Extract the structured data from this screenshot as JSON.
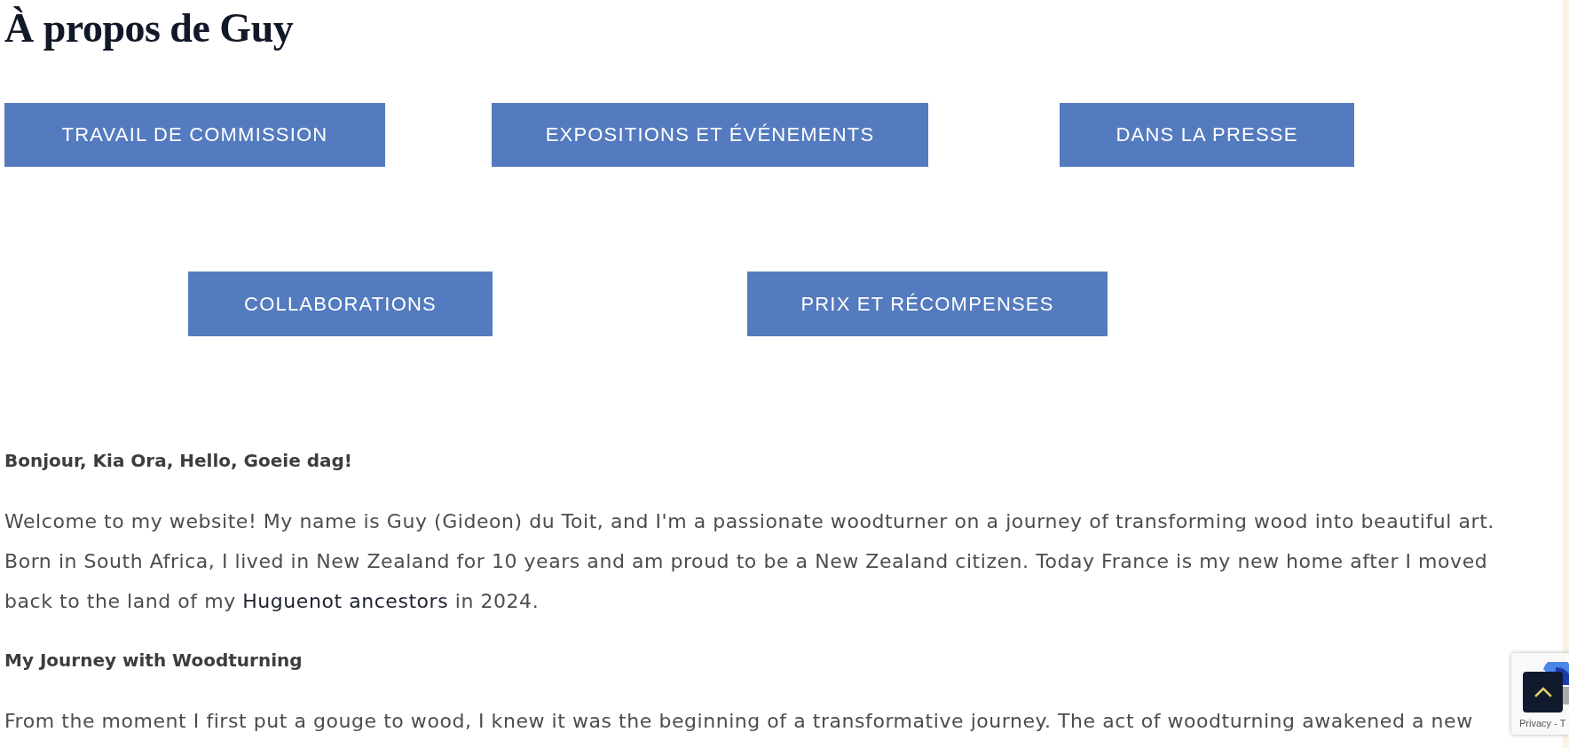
{
  "page_title": "À propos de Guy",
  "button_rows": [
    {
      "buttons": [
        {
          "label": "TRAVAIL DE COMMISSION"
        },
        {
          "label": "EXPOSITIONS ET ÉVÉNEMENTS"
        },
        {
          "label": "DANS LA PRESSE"
        }
      ]
    },
    {
      "buttons": [
        {
          "label": "COLLABORATIONS"
        },
        {
          "label": "PRIX ET RÉCOMPENSES"
        }
      ]
    }
  ],
  "content": [
    {
      "kind": "heading",
      "text": "Bonjour, Kia Ora, Hello, Goeie dag!"
    },
    {
      "kind": "paragraph",
      "segments": [
        {
          "kind": "text",
          "text": "Welcome to my website! My name is Guy (Gideon) du Toit, and I'm a passionate woodturner on a journey of transforming wood into beautiful art. Born in South Africa, I lived in New Zealand for 10 years and am proud to be a New Zealand citizen. Today France is my new home after I moved back to the land of my "
        },
        {
          "kind": "link",
          "text": "Huguenot ancestors"
        },
        {
          "kind": "text",
          "text": " in 2024."
        }
      ]
    },
    {
      "kind": "heading",
      "text": "My Journey with Woodturning"
    },
    {
      "kind": "paragraph",
      "segments": [
        {
          "kind": "text",
          "text": "From the moment I first put a gouge to wood, I knew it was the beginning of a transformative journey. The act of woodturning awakened a new"
        }
      ]
    }
  ],
  "privacy_badge": {
    "text": "Privacy - T"
  }
}
